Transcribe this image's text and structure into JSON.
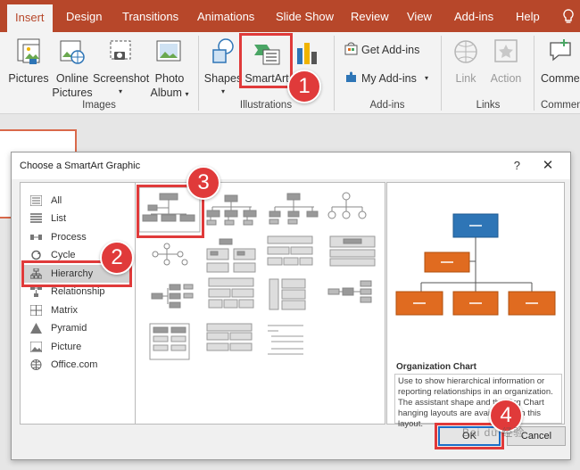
{
  "ribbon_tabs": [
    "Insert",
    "Design",
    "Transitions",
    "Animations",
    "Slide Show",
    "Review",
    "View",
    "Add-ins",
    "Help"
  ],
  "tell_me_icon": "lightbulb-icon",
  "groups": {
    "images": {
      "label": "Images",
      "pictures": "Pictures",
      "online_pictures_1": "Online",
      "online_pictures_2": "Pictures",
      "screenshot": "Screenshot",
      "photo_album_1": "Photo",
      "photo_album_2": "Album"
    },
    "illustrations": {
      "label": "Illustrations",
      "shapes": "Shapes",
      "smartart": "SmartArt",
      "chart_partial": "t"
    },
    "addins": {
      "label": "Add-ins",
      "get_addins": "Get Add-ins",
      "my_addins": "My Add-ins"
    },
    "links": {
      "label": "Links",
      "link": "Link",
      "action": "Action"
    },
    "comments": {
      "label": "Commen",
      "comment": "Comme"
    }
  },
  "dialog": {
    "title": "Choose a SmartArt Graphic",
    "help": "?",
    "close": "✕",
    "categories": [
      {
        "label": "All",
        "icon": "all-icon"
      },
      {
        "label": "List",
        "icon": "list-icon"
      },
      {
        "label": "Process",
        "icon": "process-icon"
      },
      {
        "label": "Cycle",
        "icon": "cycle-icon"
      },
      {
        "label": "Hierarchy",
        "icon": "hierarchy-icon"
      },
      {
        "label": "Relationship",
        "icon": "relationship-icon"
      },
      {
        "label": "Matrix",
        "icon": "matrix-icon"
      },
      {
        "label": "Pyramid",
        "icon": "pyramid-icon"
      },
      {
        "label": "Picture",
        "icon": "picture-icon"
      },
      {
        "label": "Office.com",
        "icon": "globe-icon"
      }
    ],
    "selected_category": "Hierarchy",
    "preview_title": "Organization Chart",
    "preview_description": "Use to show hierarchical information or reporting relationships in an organization. The assistant shape and the Org Chart hanging layouts are available with this layout.",
    "ok_label": "OK",
    "cancel_label": "Cancel"
  },
  "steps": [
    "1",
    "2",
    "3",
    "4"
  ],
  "watermark": "Bai du 经验",
  "colors": {
    "ribbon": "#b7472a",
    "highlight": "#e03a3a",
    "preview_top": "#2e75b6",
    "preview_bottom": "#e06b20"
  }
}
